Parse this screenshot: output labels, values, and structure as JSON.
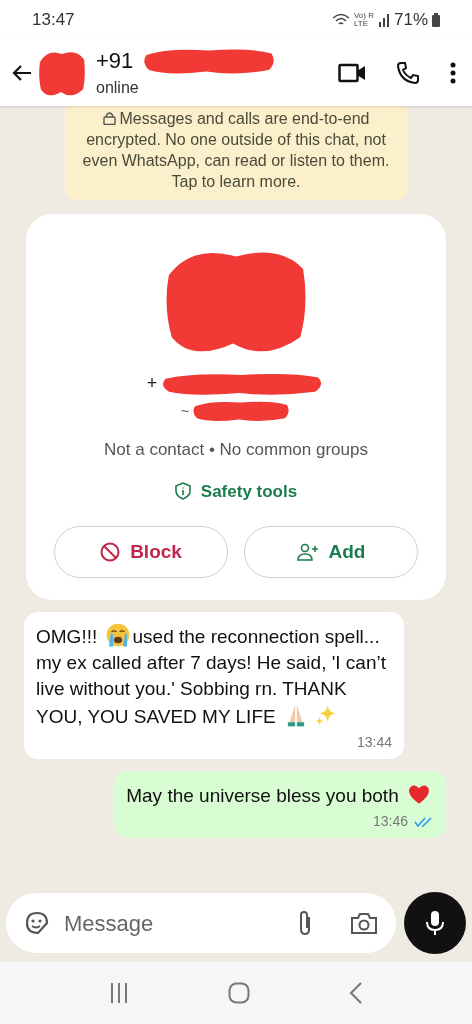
{
  "status_bar": {
    "time": "13:47",
    "carrier": "Vo) R",
    "network": "LTE",
    "battery": "71%"
  },
  "header": {
    "name": "+91",
    "name_redacted": true,
    "avatar_redacted": true,
    "status": "online"
  },
  "encryption_notice": "Messages and calls are end-to-end encrypted. No one outside of this chat, not even WhatsApp, can read or listen to them. Tap to learn more.",
  "contact_card": {
    "avatar_redacted": true,
    "number": "+",
    "number_redacted": true,
    "name": "~",
    "name_redacted": true,
    "info": "Not a contact • No common groups",
    "safety_tools": "Safety tools",
    "buttons": [
      {
        "kind": "block",
        "label": "Block"
      },
      {
        "kind": "add",
        "label": "Add"
      }
    ]
  },
  "messages": [
    {
      "kind": "incoming",
      "time": "13:44",
      "parts": [
        {
          "kind": "text",
          "text": "OMG!!!"
        },
        {
          "kind": "crying-emoji"
        },
        {
          "kind": "text",
          "text": "used the reconnection spell... my ex called after 7 days! He said, 'I can’t live without you.' Sobbing rn. THANK YOU, YOU SAVED MY LIFE"
        },
        {
          "kind": "praying-emoji"
        },
        {
          "kind": "sparkles-emoji"
        }
      ]
    },
    {
      "kind": "outgoing",
      "time": "13:46",
      "read": true,
      "parts": [
        {
          "kind": "text",
          "text": "May the universe bless you both"
        },
        {
          "kind": "heart-emoji"
        }
      ]
    }
  ],
  "composer": {
    "placeholder": "Message"
  }
}
